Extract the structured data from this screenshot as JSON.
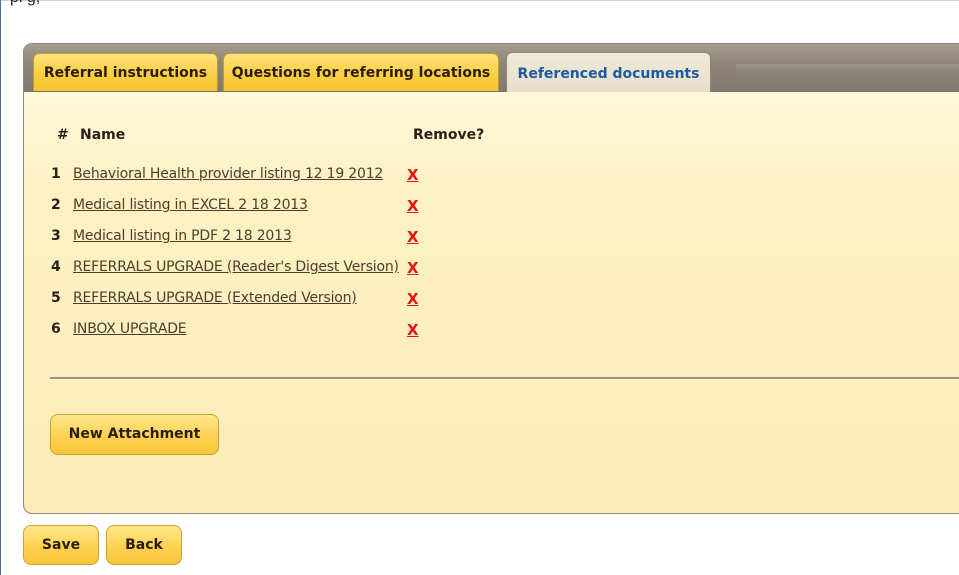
{
  "header": {
    "cutoff_text": "pl                                                          g,"
  },
  "tabs": [
    {
      "label": "Referral instructions",
      "active": false
    },
    {
      "label": "Questions for referring locations",
      "active": false
    },
    {
      "label": "Referenced documents",
      "active": true
    }
  ],
  "table": {
    "columns": {
      "number": "#",
      "name": "Name",
      "remove": "Remove?"
    },
    "remove_symbol": "X",
    "rows": [
      {
        "number": "1",
        "name": "Behavioral Health provider listing 12 19 2012"
      },
      {
        "number": "2",
        "name": "Medical listing in EXCEL 2 18 2013"
      },
      {
        "number": "3",
        "name": "Medical listing in PDF 2 18 2013"
      },
      {
        "number": "4",
        "name": "REFERRALS UPGRADE (Reader's Digest Version)"
      },
      {
        "number": "5",
        "name": "REFERRALS UPGRADE (Extended Version)"
      },
      {
        "number": "6",
        "name": "INBOX UPGRADE"
      }
    ]
  },
  "buttons": {
    "new_attachment": "New Attachment",
    "save": "Save",
    "back": "Back"
  },
  "colors": {
    "tab_active_text": "#1a5aa0",
    "remove_red": "#e21414",
    "panel_bg": "#fdf1c4",
    "button_gold": "#fcd04e"
  }
}
